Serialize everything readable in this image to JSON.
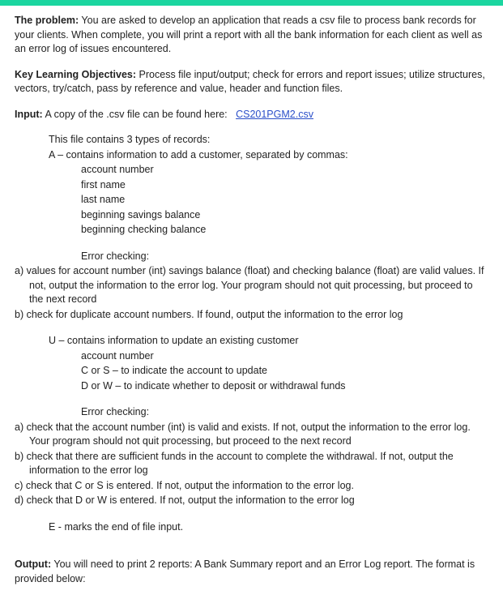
{
  "topColor": "#1bd6a0",
  "problem": {
    "label": "The problem:",
    "text": "You are asked to develop an application that reads a csv file to process bank records for your clients. When complete, you will print a report with all the bank information for each client as well as an error log of issues encountered."
  },
  "objectives": {
    "label": "Key Learning Objectives:",
    "text": "Process file input/output; check for errors and report issues; utilize structures, vectors, try/catch, pass by reference and value, header and function files."
  },
  "input": {
    "label": "Input:",
    "lead": "A copy of the .csv file can be found here:",
    "link": "CS201PGM2.csv",
    "intro": "This file contains 3 types of records:",
    "recA": {
      "head": "A – contains information to add a customer, separated by commas:",
      "fields": [
        "account number",
        "first name",
        "last name",
        "beginning savings balance",
        "beginning checking balance"
      ],
      "errHead": "Error checking:",
      "errors": [
        "a)  values for account number (int) savings balance (float) and checking balance (float) are valid values.  If not, output the information to the error log.  Your program should not quit processing, but proceed to the next record",
        "b)   check for duplicate account numbers.  If found, output the information to the error log"
      ]
    },
    "recU": {
      "head": "U – contains information to update an existing customer",
      "fields": [
        "account number",
        "C or S – to indicate the account to update",
        "D or W – to indicate whether to deposit or withdrawal funds"
      ],
      "errHead": "Error checking:",
      "errors": [
        "a)   check that the account number (int) is valid and exists. If not, output the information to the error log.  Your program should not quit processing, but proceed to the next record",
        "b)   check that there are sufficient funds in the account to complete the withdrawal. If not, output the information to the error log",
        "c)   check that C or S is entered. If not, output the information to the error log.",
        "d)   check that D or W is entered. If not, output the information to the error log"
      ]
    },
    "recE": "E  -  marks the end of file input."
  },
  "output": {
    "label": "Output:",
    "text": "You will need to print 2 reports:  A Bank Summary report and an Error Log report.  The format is provided below:"
  }
}
